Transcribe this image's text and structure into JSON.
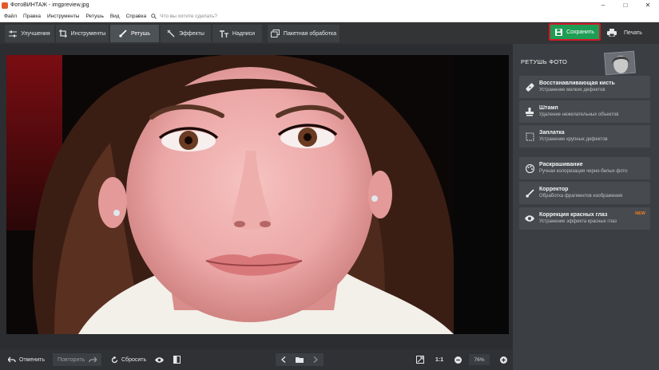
{
  "window": {
    "title": "ФотоВИНТАЖ - imgpreview.jpg",
    "controls": [
      "–",
      "□",
      "✕"
    ]
  },
  "menu": {
    "items": [
      "Файл",
      "Правка",
      "Инструменты",
      "Ретушь",
      "Вид",
      "Справка"
    ],
    "search_placeholder": "Что вы хотите сделать?"
  },
  "toolbar": {
    "tabs": [
      {
        "label": "Улучшения",
        "icon": "sliders-icon"
      },
      {
        "label": "Инструменты",
        "icon": "crop-icon"
      },
      {
        "label": "Ретушь",
        "icon": "brush-icon",
        "active": true
      },
      {
        "label": "Эффекты",
        "icon": "magic-wand-icon"
      },
      {
        "label": "Надписи",
        "icon": "text-icon"
      },
      {
        "label": "Пакетная обработка",
        "icon": "batch-icon"
      }
    ],
    "save_label": "Сохранить",
    "print_label": "Печать"
  },
  "panel": {
    "title": "РЕТУШЬ ФОТО",
    "tools": [
      {
        "name": "Восстанавливающая кисть",
        "desc": "Устранение мелких дефектов",
        "icon": "healing-brush-icon"
      },
      {
        "name": "Штамп",
        "desc": "Удаление нежелательных объектов",
        "icon": "stamp-icon"
      },
      {
        "name": "Заплатка",
        "desc": "Устранение крупных дефектов",
        "icon": "patch-icon"
      },
      {
        "name": "Раскрашивание",
        "desc": "Ручная колоризация черно-белых фото",
        "icon": "palette-icon"
      },
      {
        "name": "Корректор",
        "desc": "Обработка фрагментов изображения",
        "icon": "corrector-brush-icon"
      },
      {
        "name": "Коррекция красных глаз",
        "desc": "Устранение эффекта красных глаз",
        "icon": "eye-icon",
        "badge": "NEW"
      }
    ]
  },
  "bottom": {
    "undo_label": "Отменить",
    "redo_label": "Повторить",
    "reset_label": "Сбросить",
    "zoom_actual": "1:1",
    "zoom_value": "76%"
  },
  "colors": {
    "accent_green": "#1e9d55",
    "highlight_red": "#d4192a",
    "badge_orange": "#f27b1c",
    "panel_bg": "#3b3e42",
    "toolbar_bg": "#323436"
  }
}
